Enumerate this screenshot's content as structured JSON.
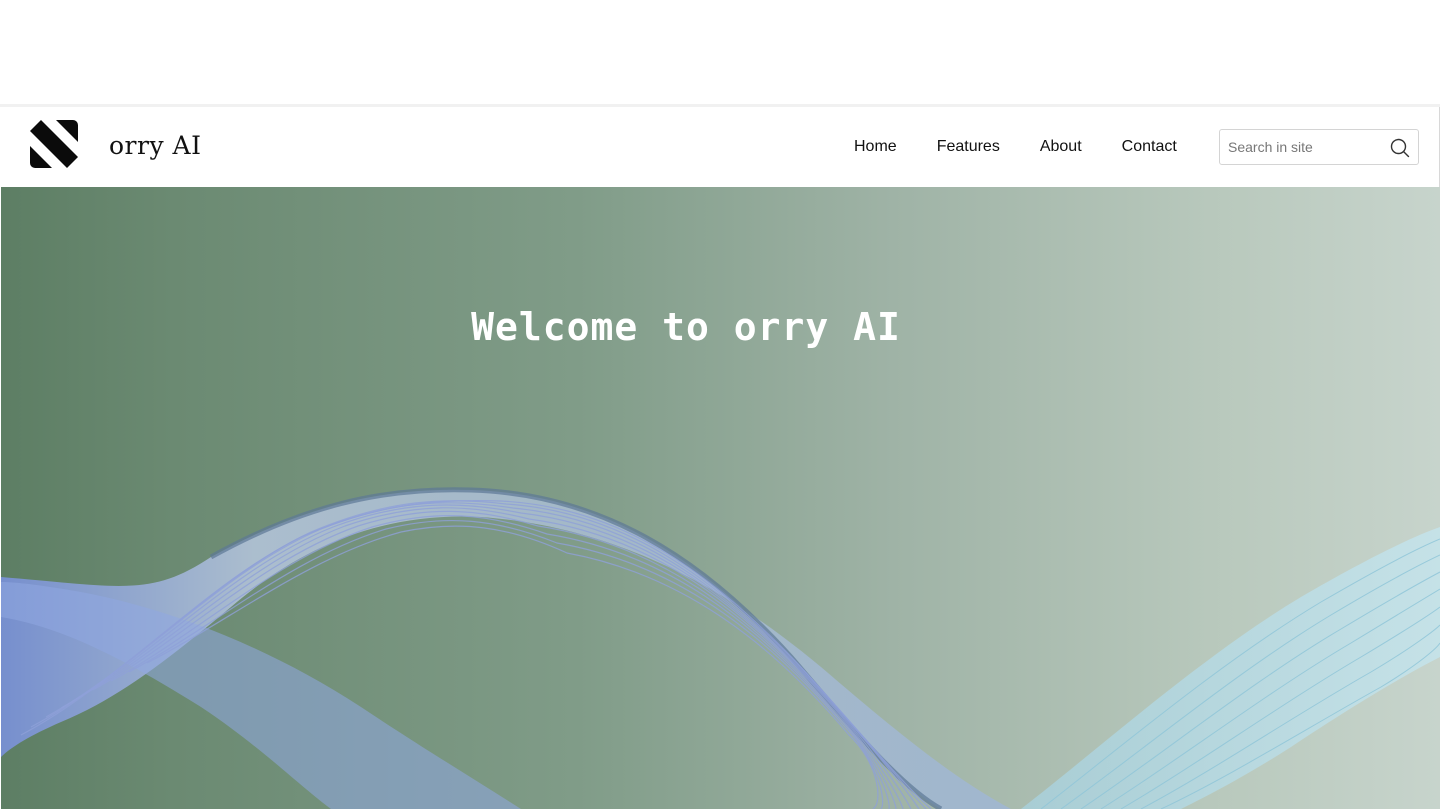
{
  "header": {
    "brand_name": "orry AI",
    "logo_icon": "brand-logo-mark",
    "nav": [
      {
        "label": "Home"
      },
      {
        "label": "Features"
      },
      {
        "label": "About"
      },
      {
        "label": "Contact"
      }
    ],
    "search": {
      "placeholder": "Search in site",
      "value": "",
      "icon": "search-icon"
    }
  },
  "hero": {
    "title": "Welcome to orry AI",
    "background_colors": [
      "#5d7e64",
      "#c7d4cc"
    ],
    "wave_color": "#9fb6d6"
  }
}
